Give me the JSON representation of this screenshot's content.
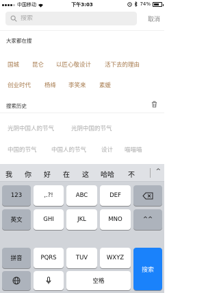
{
  "status_bar": {
    "carrier": "中国移动",
    "time": "下午3:03",
    "battery_text": "74%",
    "battery_level": 0.74
  },
  "search": {
    "placeholder": "搜索",
    "cancel_label": "取消"
  },
  "hot": {
    "title": "大家都在搜",
    "tags": [
      "国城",
      "昆仑",
      "以匠心敬设计",
      "活下去的理由",
      "创业时代",
      "杨绛",
      "李笑来",
      "素媛"
    ]
  },
  "history": {
    "title": "搜索历史",
    "items": [
      "光阴中国人的节气",
      "光阴中国的节气",
      "中国的节气",
      "中国人的节气",
      "设计",
      "喵喵喵"
    ]
  },
  "keyboard": {
    "candidates": [
      "我",
      "你",
      "好",
      "在",
      "这",
      "哈哈",
      "不"
    ],
    "candidates_toggle": "^",
    "row1": [
      "123",
      ",.?!",
      "ABC",
      "DEF"
    ],
    "row2": [
      "英文",
      "GHI",
      "JKL",
      "MNO",
      "^^"
    ],
    "row3": [
      "拼音",
      "PQRS",
      "TUV",
      "WXYZ"
    ],
    "search_key": "搜索",
    "space_key": "空格"
  },
  "colors": {
    "hot_tag": "#a67a4d",
    "history_tag": "#aaaaaa",
    "search_key": "#1a82fb"
  }
}
